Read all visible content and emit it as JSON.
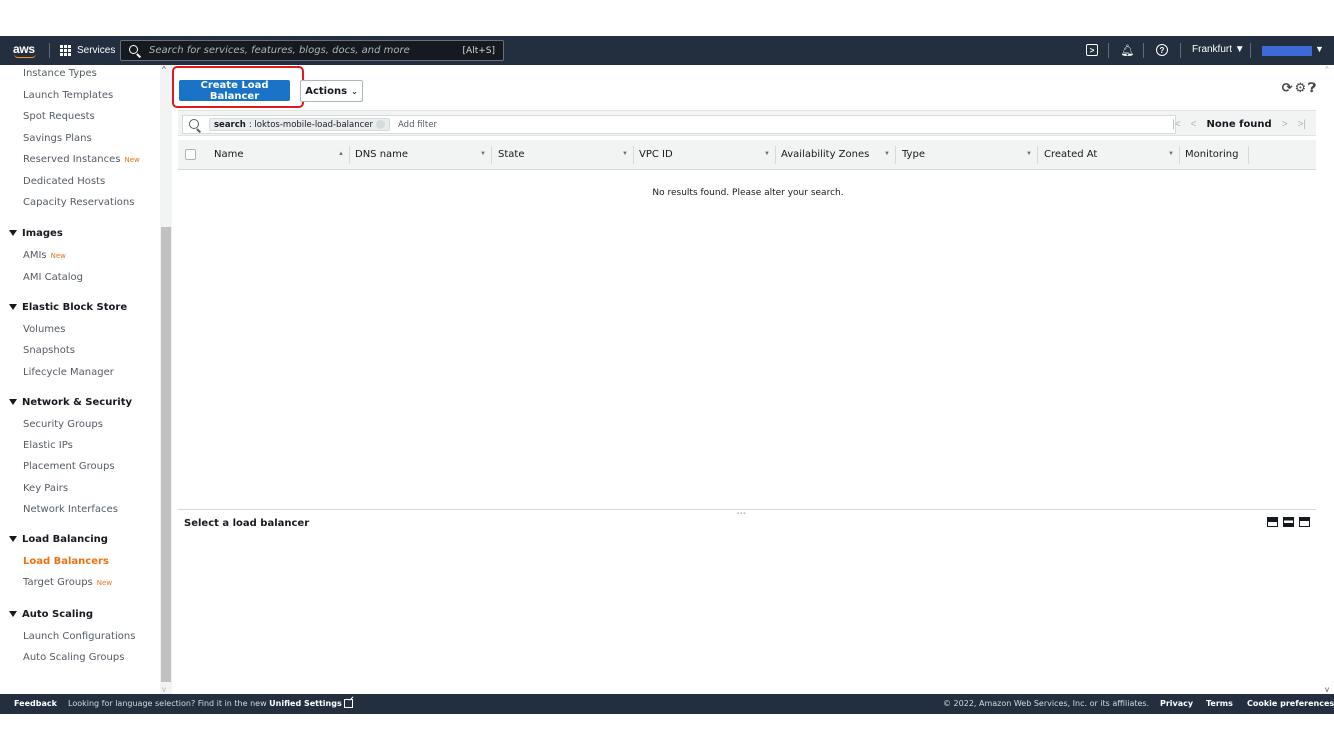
{
  "topnav": {
    "logo_text": "aws",
    "services_label": "Services",
    "search_placeholder": "Search for services, features, blogs, docs, and more",
    "search_shortcut": "[Alt+S]",
    "region": "Frankfurt ▼",
    "colors": {
      "background": "#232f3e",
      "account_chip": "#3c6bd9",
      "logo_smile": "#ff9900"
    }
  },
  "sidebar": {
    "items": [
      {
        "label": "Instance Types"
      },
      {
        "label": "Launch Templates"
      },
      {
        "label": "Spot Requests"
      },
      {
        "label": "Savings Plans"
      },
      {
        "label": "Reserved Instances",
        "badge": "New"
      },
      {
        "label": "Dedicated Hosts"
      },
      {
        "label": "Capacity Reservations"
      }
    ],
    "sections": [
      {
        "title": "Images",
        "items": [
          {
            "label": "AMIs",
            "badge": "New"
          },
          {
            "label": "AMI Catalog"
          }
        ]
      },
      {
        "title": "Elastic Block Store",
        "items": [
          {
            "label": "Volumes"
          },
          {
            "label": "Snapshots"
          },
          {
            "label": "Lifecycle Manager"
          }
        ]
      },
      {
        "title": "Network & Security",
        "items": [
          {
            "label": "Security Groups"
          },
          {
            "label": "Elastic IPs"
          },
          {
            "label": "Placement Groups"
          },
          {
            "label": "Key Pairs"
          },
          {
            "label": "Network Interfaces"
          }
        ]
      },
      {
        "title": "Load Balancing",
        "items": [
          {
            "label": "Load Balancers",
            "active": true
          },
          {
            "label": "Target Groups",
            "badge": "New"
          }
        ]
      },
      {
        "title": "Auto Scaling",
        "items": [
          {
            "label": "Launch Configurations"
          },
          {
            "label": "Auto Scaling Groups"
          }
        ]
      }
    ],
    "colors": {
      "active": "#ec7211",
      "badge": "#ec7211"
    }
  },
  "toolbar": {
    "create_label": "Create Load Balancer",
    "actions_label": "Actions",
    "colors": {
      "create_button": "#1a73c7",
      "highlight": "#e0191f"
    }
  },
  "filter": {
    "token_key": "search",
    "token_value": ": loktos-mobile-load-balancer",
    "add_filter_placeholder": "Add filter",
    "pager_status": "None found"
  },
  "table": {
    "columns": [
      "Name",
      "DNS name",
      "State",
      "VPC ID",
      "Availability Zones",
      "Type",
      "Created At",
      "Monitoring"
    ],
    "empty_message": "No results found. Please alter your search."
  },
  "detail": {
    "title": "Select a load balancer"
  },
  "footer": {
    "feedback": "Feedback",
    "language_text": "Looking for language selection? Find it in the new ",
    "unified_settings": "Unified Settings",
    "copyright": "© 2022, Amazon Web Services, Inc. or its affiliates.",
    "privacy": "Privacy",
    "terms": "Terms",
    "cookie": "Cookie preferences"
  }
}
